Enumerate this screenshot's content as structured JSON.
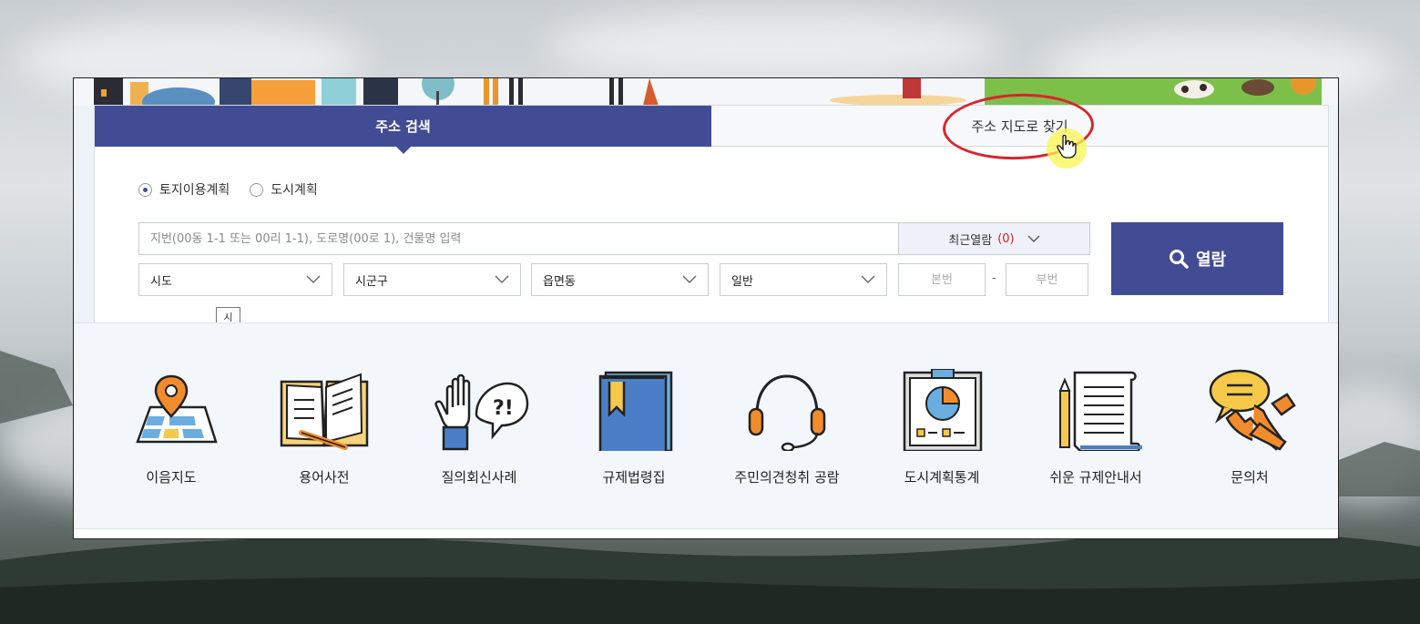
{
  "tabs": {
    "address_search": "주소 검색",
    "address_map": "주소 지도로 찾기"
  },
  "plan_type": {
    "options": [
      "토지이용계획",
      "도시계획"
    ],
    "selected": "토지이용계획"
  },
  "search": {
    "placeholder": "지번(00동 1-1 또는 00리 1-1), 도로명(00로 1), 건물명 입력",
    "recent_label": "최근열람",
    "recent_count": "(0)",
    "view_button": "열람"
  },
  "selects": {
    "sido": "시도",
    "sigungu": "시군구",
    "eupmyeondong": "읍면동",
    "land_type": "일반"
  },
  "lot_number": {
    "main_placeholder": "본번",
    "separator": "-",
    "sub_placeholder": "부번"
  },
  "tooltip": "시",
  "quick_links": [
    {
      "label": "이음지도",
      "icon": "map-pin-icon"
    },
    {
      "label": "용어사전",
      "icon": "open-book-icon"
    },
    {
      "label": "질의회신사례",
      "icon": "question-hand-icon"
    },
    {
      "label": "규제법령집",
      "icon": "law-book-icon"
    },
    {
      "label": "주민의견청취 공람",
      "icon": "headset-icon"
    },
    {
      "label": "도시계획통계",
      "icon": "pie-chart-board-icon"
    },
    {
      "label": "쉬운 규제안내서",
      "icon": "document-pencil-icon"
    },
    {
      "label": "문의처",
      "icon": "phone-chat-icon"
    }
  ],
  "colors": {
    "primary": "#424c94",
    "accent_red": "#d0202a",
    "highlight": "#d8252c"
  }
}
